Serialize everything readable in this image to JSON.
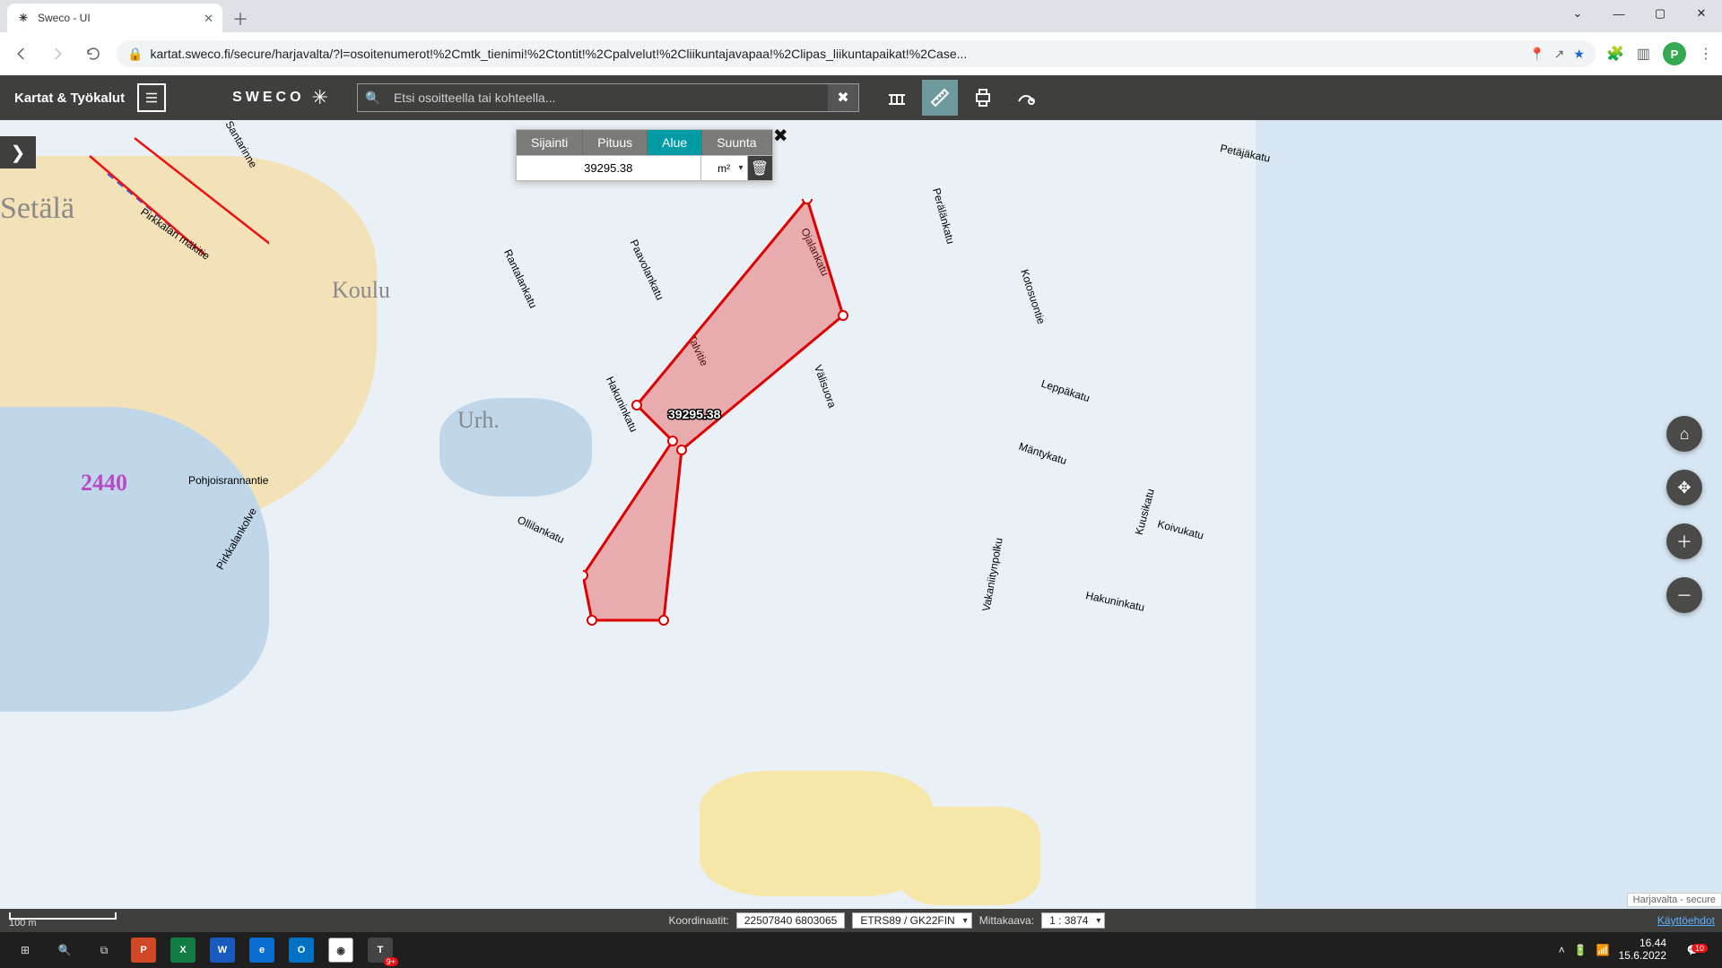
{
  "browser": {
    "tab_title": "Sweco - UI",
    "url": "kartat.sweco.fi/secure/harjavalta/?l=osoitenumerot!%2Cmtk_tienimi!%2Ctontit!%2Cpalvelut!%2Cliikuntajavapaa!%2Clipas_liikuntapaikat!%2Case...",
    "profile_letter": "P"
  },
  "header": {
    "brand": "Kartat & Työkalut",
    "logo": "SWECO",
    "search_placeholder": "Etsi osoitteella tai kohteella..."
  },
  "measure_panel": {
    "tabs": {
      "sijainti": "Sijainti",
      "pituus": "Pituus",
      "alue": "Alue",
      "suunta": "Suunta"
    },
    "active_tab": "alue",
    "value": "39295.38",
    "unit": "m²"
  },
  "map": {
    "side_expand_glyph": "❯",
    "labels": {
      "setala": "Setälä",
      "koulu": "Koulu",
      "urh": "Urh.",
      "n2440": "2440"
    },
    "streets": {
      "santarinne": "Santarinne",
      "pirkkalan_makitie": "Pirkkalan mäkitie",
      "pirkkalankolve": "Pirkkalankolve",
      "pohjoisrannantie": "Pohjoisrannantie",
      "rantalankatu": "Rantalankatu",
      "paavolankatu": "Paavolankatu",
      "ollilankatu": "Ollilankatu",
      "hakuninkatu": "Hakuninkatu",
      "talvitie": "Talvitie",
      "valisuora": "Välisuora",
      "ojalankatu": "Ojalankatu",
      "peralankatu": "Perälänkatu",
      "kotosuontie": "Kotosuontie",
      "leppakatu": "Leppäkatu",
      "mantykatu": "Mäntykatu",
      "kuusikatu": "Kuusikatu",
      "koivukatu": "Koivukatu",
      "petajakatu": "Petäjäkatu",
      "hakuninkatu2": "Hakuninkatu",
      "vakaniitynpolku": "Vakaniitynpolku"
    },
    "measurement_label": "39295.38",
    "attribution": "Harjavalta - secure"
  },
  "status": {
    "scale_text": "100 m",
    "coord_label": "Koordinaatit:",
    "coord_value": "22507840 6803065",
    "crs": "ETRS89 / GK22FIN",
    "scale_label": "Mittakaava:",
    "scale_value": "1 : 3874",
    "terms": "Käyttöehdot"
  },
  "taskbar": {
    "time": "16.44",
    "date": "15.6.2022",
    "notif_count": "10",
    "teams_badge": "9+"
  }
}
